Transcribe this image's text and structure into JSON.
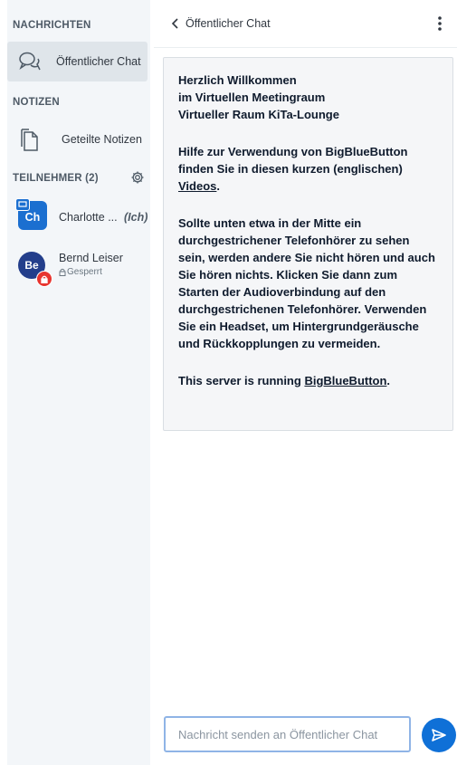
{
  "sidebar": {
    "messages_heading": "NACHRICHTEN",
    "public_chat_label": "Öffentlicher Chat",
    "notes_heading": "NOTIZEN",
    "shared_notes_label": "Geteilte Notizen",
    "participants_heading": "TEILNEHMER (2)",
    "users": [
      {
        "initials": "Ch",
        "name": "Charlotte ...",
        "you_tag": "(Ich)",
        "color": "#1b6fd0"
      },
      {
        "initials": "Be",
        "name": "Bernd Leiser",
        "status": "Gesperrt",
        "color": "#233e8b",
        "locked_badge_color": "#e8342f"
      }
    ]
  },
  "chat": {
    "title": "Öffentlicher Chat",
    "welcome": {
      "line1": "Herzlich Willkommen",
      "line2": "im Virtuellen Meetingraum",
      "line3": "Virtueller Raum KiTa-Lounge",
      "help_line1": "Hilfe zur Verwendung von BigBlueButton",
      "help_line2": "finden Sie in diesen kurzen (englischen)",
      "help_link": "Videos",
      "help_after": ".",
      "p3": [
        "Sollte unten etwa in der Mitte ein",
        "durchgestrichener Telefonhörer zu sehen",
        "sein, werden andere Sie nicht hören und auch",
        "Sie hören nichts. Klicken Sie dann zum",
        "Starten der Audioverbindung auf den",
        "durchgestrichenen Telefonhörer. Verwenden",
        "Sie ein Headset, um Hintergrundgeräusche",
        "und Rückkopplungen zu vermeiden."
      ],
      "server_prefix": "This server is running ",
      "server_link": "BigBlueButton",
      "server_suffix": "."
    },
    "input_placeholder": "Nachricht senden an Öffentlicher Chat"
  },
  "colors": {
    "accent": "#0f70d7",
    "sidebar_bg": "#f3f6f9",
    "input_border": "#8fb4e6"
  },
  "icons": {
    "chat": "chat-bubbles-icon",
    "notes": "document-icon",
    "settings": "gear-icon",
    "back": "chevron-left-icon",
    "menu": "more-vertical-icon",
    "send": "send-icon",
    "lock": "lock-icon"
  }
}
